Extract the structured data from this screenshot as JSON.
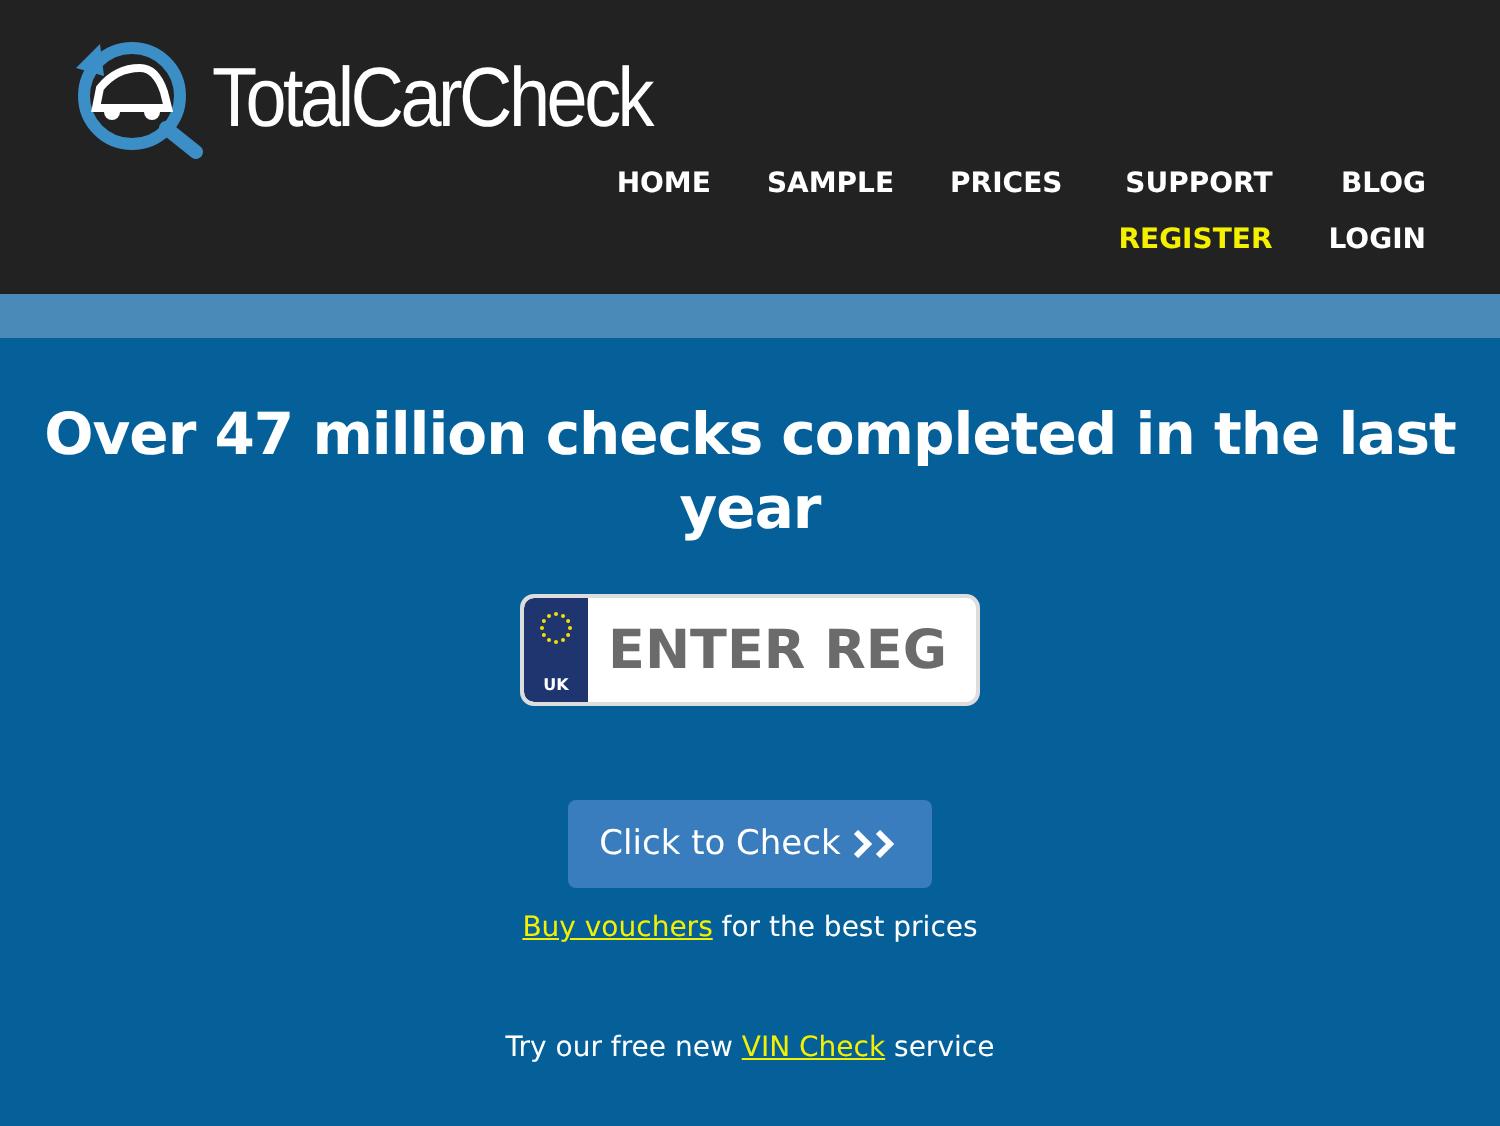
{
  "logo": {
    "text": "TotalCarCheck"
  },
  "nav": [
    {
      "label": "HOME",
      "highlighted": false
    },
    {
      "label": "SAMPLE",
      "highlighted": false
    },
    {
      "label": "PRICES",
      "highlighted": false
    },
    {
      "label": "SUPPORT",
      "highlighted": false
    },
    {
      "label": "BLOG",
      "highlighted": false
    },
    {
      "label": "REGISTER",
      "highlighted": true
    },
    {
      "label": "LOGIN",
      "highlighted": false
    }
  ],
  "headline": "Over 47 million checks completed in the last year",
  "plate": {
    "badge": "UK",
    "placeholder": "ENTER REG"
  },
  "check_button": "Click to Check",
  "vouchers": {
    "link": "Buy vouchers",
    "after": " for the best prices"
  },
  "vin": {
    "before": "Try our free new ",
    "link": "VIN Check",
    "after": " service"
  }
}
